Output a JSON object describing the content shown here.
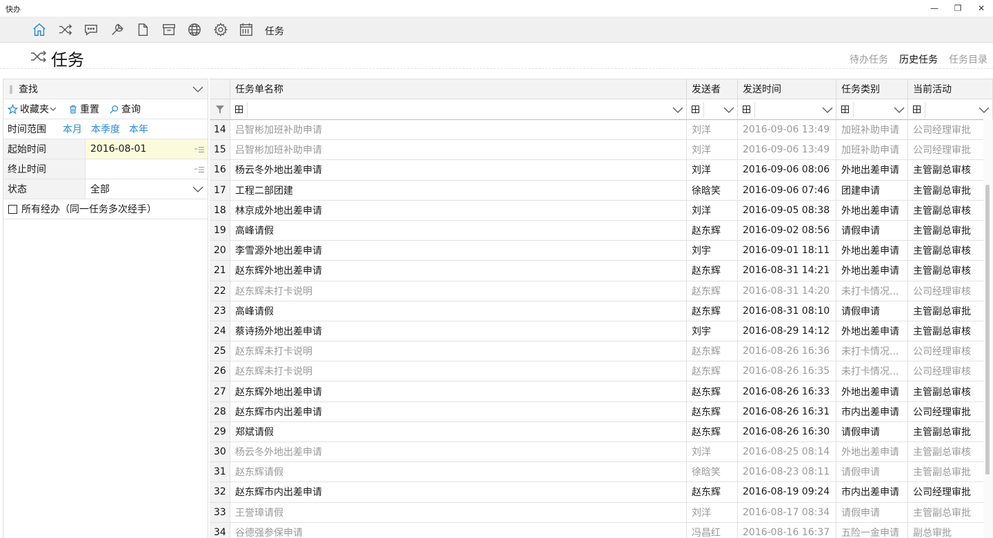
{
  "app": {
    "title": "快办"
  },
  "window_controls": {
    "minimize": "—",
    "restore": "❐",
    "close": "✕"
  },
  "toolbar": {
    "label": "任务"
  },
  "header": {
    "title": "任务",
    "tabs": [
      {
        "label": "待办任务",
        "active": false
      },
      {
        "label": "历史任务",
        "active": true
      },
      {
        "label": "任务目录",
        "active": false
      }
    ]
  },
  "search": {
    "title": "查找",
    "favorites": "收藏夹",
    "reset": "重置",
    "query": "查询",
    "time_range_label": "时间范围",
    "ranges": [
      "本月",
      "本季度",
      "本年"
    ],
    "start_label": "起始时间",
    "start_value": "2016-08-01",
    "end_label": "终止时间",
    "end_value": "",
    "status_label": "状态",
    "status_value": "全部",
    "all_handled_label": "所有经办（同一任务多次经手）"
  },
  "table": {
    "columns": [
      "任务单名称",
      "发送者",
      "发送时间",
      "任务类别",
      "当前活动"
    ],
    "rows": [
      {
        "no": "14",
        "name": "吕智彬加班补助申请",
        "sender": "刘洋",
        "time": "2016-09-06 13:49",
        "type": "加班补助申请",
        "activity": "公司经理审批",
        "dim": true
      },
      {
        "no": "15",
        "name": "吕智彬加班补助申请",
        "sender": "刘洋",
        "time": "2016-09-06 13:49",
        "type": "加班补助申请",
        "activity": "公司经理审批",
        "dim": true
      },
      {
        "no": "16",
        "name": "杨云冬外地出差申请",
        "sender": "刘洋",
        "time": "2016-09-06 08:06",
        "type": "外地出差申请",
        "activity": "主管副总审核",
        "dim": false
      },
      {
        "no": "17",
        "name": "工程二部团建",
        "sender": "徐晗笑",
        "time": "2016-09-06 07:46",
        "type": "团建申请",
        "activity": "主管副总审批",
        "dim": false
      },
      {
        "no": "18",
        "name": "林京成外地出差申请",
        "sender": "刘洋",
        "time": "2016-09-05 08:38",
        "type": "外地出差申请",
        "activity": "主管副总审核",
        "dim": false
      },
      {
        "no": "19",
        "name": "高峰请假",
        "sender": "赵东辉",
        "time": "2016-09-02 08:56",
        "type": "请假申请",
        "activity": "主管副总审批",
        "dim": false
      },
      {
        "no": "20",
        "name": "李雪源外地出差申请",
        "sender": "刘宇",
        "time": "2016-09-01 18:11",
        "type": "外地出差申请",
        "activity": "主管副总审核",
        "dim": false
      },
      {
        "no": "21",
        "name": "赵东辉外地出差申请",
        "sender": "赵东辉",
        "time": "2016-08-31 14:21",
        "type": "外地出差申请",
        "activity": "主管副总审核",
        "dim": false
      },
      {
        "no": "22",
        "name": "赵东辉未打卡说明",
        "sender": "赵东辉",
        "time": "2016-08-31 14:20",
        "type": "未打卡情况...",
        "activity": "公司经理审核",
        "dim": true
      },
      {
        "no": "23",
        "name": "高峰请假",
        "sender": "赵东辉",
        "time": "2016-08-31 08:10",
        "type": "请假申请",
        "activity": "主管副总审批",
        "dim": false
      },
      {
        "no": "24",
        "name": "蔡诗扬外地出差申请",
        "sender": "刘宇",
        "time": "2016-08-29 14:12",
        "type": "外地出差申请",
        "activity": "主管副总审核",
        "dim": false
      },
      {
        "no": "25",
        "name": "赵东辉未打卡说明",
        "sender": "赵东辉",
        "time": "2016-08-26 16:36",
        "type": "未打卡情况...",
        "activity": "公司经理审核",
        "dim": true
      },
      {
        "no": "26",
        "name": "赵东辉未打卡说明",
        "sender": "赵东辉",
        "time": "2016-08-26 16:35",
        "type": "未打卡情况...",
        "activity": "公司经理审核",
        "dim": true
      },
      {
        "no": "27",
        "name": "赵东辉外地出差申请",
        "sender": "赵东辉",
        "time": "2016-08-26 16:33",
        "type": "外地出差申请",
        "activity": "主管副总审核",
        "dim": false
      },
      {
        "no": "28",
        "name": "赵东辉市内出差申请",
        "sender": "赵东辉",
        "time": "2016-08-26 16:31",
        "type": "市内出差申请",
        "activity": "公司经理审批",
        "dim": false
      },
      {
        "no": "29",
        "name": "郑斌请假",
        "sender": "赵东辉",
        "time": "2016-08-26 16:30",
        "type": "请假申请",
        "activity": "主管副总审批",
        "dim": false
      },
      {
        "no": "30",
        "name": "杨云冬外地出差申请",
        "sender": "刘洋",
        "time": "2016-08-25 08:14",
        "type": "外地出差申请",
        "activity": "主管副总审核",
        "dim": true
      },
      {
        "no": "31",
        "name": "赵东辉请假",
        "sender": "徐晗笑",
        "time": "2016-08-23 08:11",
        "type": "请假申请",
        "activity": "主管副总审批",
        "dim": true
      },
      {
        "no": "32",
        "name": "赵东辉市内出差申请",
        "sender": "赵东辉",
        "time": "2016-08-19 09:24",
        "type": "市内出差申请",
        "activity": "公司经理审批",
        "dim": false
      },
      {
        "no": "33",
        "name": "王誉璋请假",
        "sender": "刘洋",
        "time": "2016-08-17 08:34",
        "type": "请假申请",
        "activity": "主管副总审批",
        "dim": true
      },
      {
        "no": "34",
        "name": "谷德强参保申请",
        "sender": "冯昌红",
        "time": "2016-08-16 16:37",
        "type": "五险一金申请",
        "activity": "副总审批",
        "dim": true
      }
    ]
  },
  "colors": {
    "accent": "#2a8ad6",
    "dim_text": "#999999",
    "highlight_field": "#fbfbdc"
  }
}
